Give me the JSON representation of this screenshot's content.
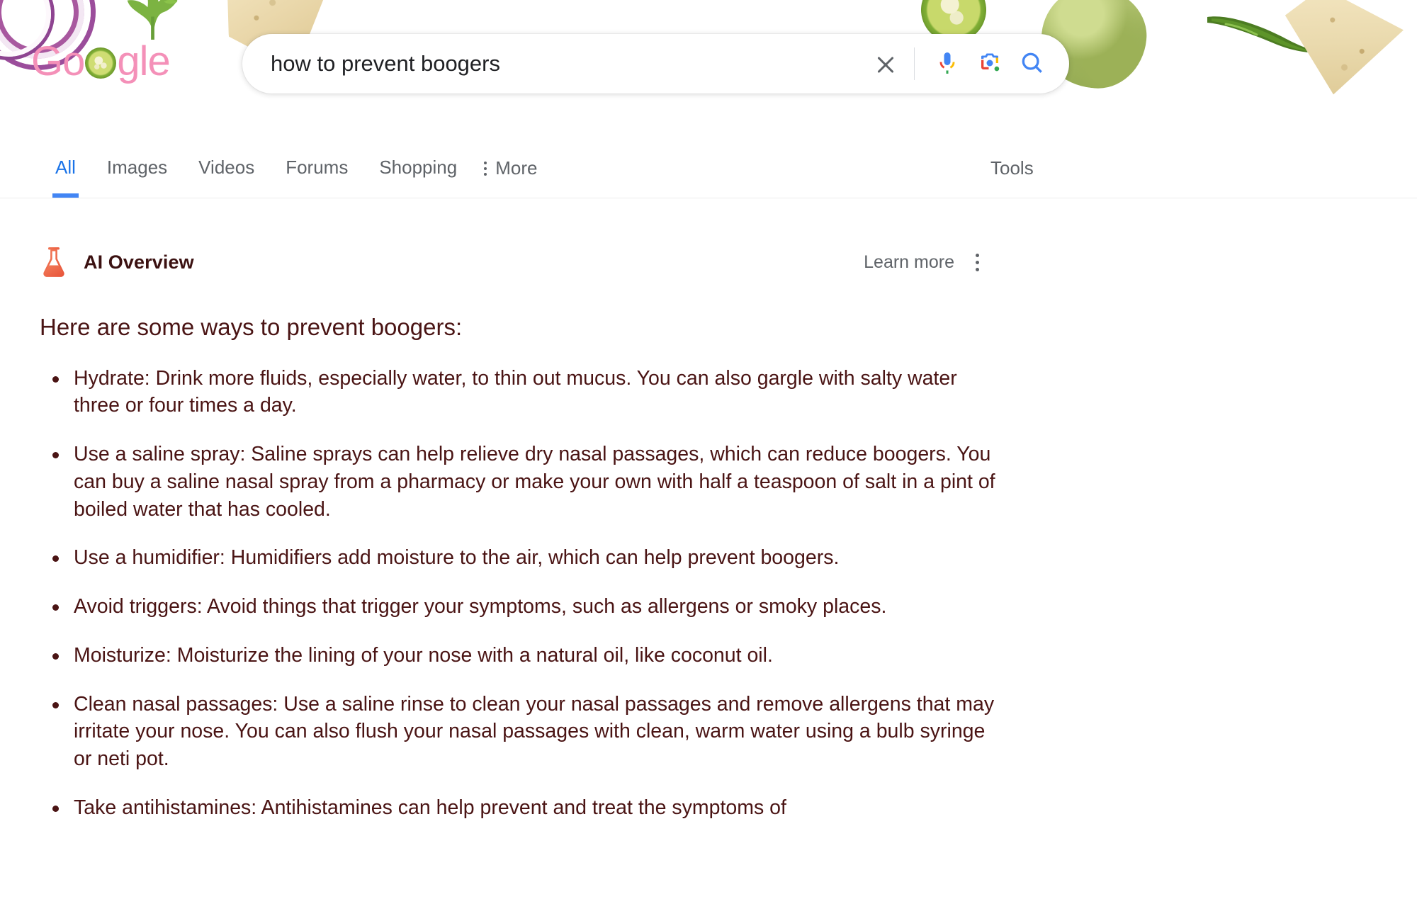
{
  "doodle": {
    "items": [
      "red-onion-rings",
      "cilantro-leaf",
      "tortilla-chip",
      "jalapeno-slice",
      "tomatillo",
      "serrano-pepper",
      "tortilla-chip-right"
    ]
  },
  "logo": {
    "part1": "G",
    "part2": "o",
    "jalapeno_o": "jalapeno-slice-letter-o",
    "part3": "gle",
    "color": "#f490b8"
  },
  "search": {
    "query": "how to prevent boogers",
    "placeholder": "Search",
    "clear_icon": "close-icon",
    "voice_icon": "microphone-icon",
    "lens_icon": "google-lens-icon",
    "search_icon": "search-icon"
  },
  "nav": {
    "tabs": [
      {
        "label": "All",
        "active": true
      },
      {
        "label": "Images",
        "active": false
      },
      {
        "label": "Videos",
        "active": false
      },
      {
        "label": "Forums",
        "active": false
      },
      {
        "label": "Shopping",
        "active": false
      }
    ],
    "more_label": "More",
    "more_icon": "dots-vertical-icon",
    "tools_label": "Tools",
    "active_color": "#1a73e8",
    "underline_color": "#4285f4"
  },
  "ai_overview": {
    "icon": "flask-icon",
    "title": "AI Overview",
    "learn_more_label": "Learn more",
    "menu_icon": "dots-vertical-icon",
    "heading": "Here are some ways to prevent boogers:",
    "text_color": "#4a1414",
    "bullets": [
      "Hydrate: Drink more fluids, especially water, to thin out mucus. You can also gargle with salty water three or four times a day.",
      "Use a saline spray: Saline sprays can help relieve dry nasal passages, which can reduce boogers. You can buy a saline nasal spray from a pharmacy or make your own with half a teaspoon of salt in a pint of boiled water that has cooled.",
      "Use a humidifier: Humidifiers add moisture to the air, which can help prevent boogers.",
      "Avoid triggers: Avoid things that trigger your symptoms, such as allergens or smoky places.",
      "Moisturize: Moisturize the lining of your nose with a natural oil, like coconut oil.",
      "Clean nasal passages: Use a saline rinse to clean your nasal passages and remove allergens that may irritate your nose. You can also flush your nasal passages with clean, warm water using a bulb syringe or neti pot.",
      "Take antihistamines: Antihistamines can help prevent and treat the symptoms of"
    ]
  }
}
